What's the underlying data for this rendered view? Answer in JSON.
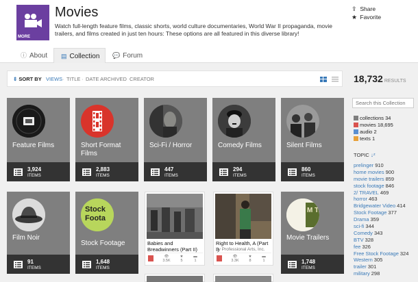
{
  "collection": {
    "logo_more": "MORE",
    "title": "Movies",
    "description": "Watch full-length feature films, classic shorts, world culture documentaries, World War II propaganda, movie trailers, and films created in just ten hours: These options are all featured in this diverse library!",
    "share_label": "Share",
    "favorite_label": "Favorite"
  },
  "tabs": [
    {
      "label": "About",
      "icon": "info-icon"
    },
    {
      "label": "Collection",
      "icon": "grid-icon",
      "active": true
    },
    {
      "label": "Forum",
      "icon": "chat-icon"
    }
  ],
  "sort": {
    "label": "SORT BY",
    "options": [
      "VIEWS",
      "TITLE",
      "DATE ARCHIVED",
      "CREATOR"
    ],
    "active": "VIEWS"
  },
  "results": {
    "count": "18,732",
    "label": "RESULTS"
  },
  "search": {
    "placeholder": "Search this Collection"
  },
  "media_facets": [
    {
      "label": "collections",
      "count": "34",
      "color": "#7f7f7f"
    },
    {
      "label": "movies",
      "count": "18,695",
      "color": "#d9534f"
    },
    {
      "label": "audio",
      "count": "2",
      "color": "#5b8fd1"
    },
    {
      "label": "texts",
      "count": "1",
      "color": "#e8a13a"
    }
  ],
  "topic_header": "TOPIC",
  "topics": [
    {
      "name": "prelinger",
      "count": "910"
    },
    {
      "name": "home movies",
      "count": "900"
    },
    {
      "name": "movie trailers",
      "count": "859"
    },
    {
      "name": "stock footage",
      "count": "846"
    },
    {
      "name": "2/ TRAVEL",
      "count": "469"
    },
    {
      "name": "horror",
      "count": "463"
    },
    {
      "name": "Bridgewater Video",
      "count": "414"
    },
    {
      "name": "Stock Footage",
      "count": "377"
    },
    {
      "name": "Drama",
      "count": "359"
    },
    {
      "name": "sci-fi",
      "count": "344"
    },
    {
      "name": "Comedy",
      "count": "343"
    },
    {
      "name": "BTV",
      "count": "328"
    },
    {
      "name": "fee",
      "count": "326"
    },
    {
      "name": "Free Stock Footage",
      "count": "324"
    },
    {
      "name": "Western",
      "count": "305"
    },
    {
      "name": "trailer",
      "count": "301"
    },
    {
      "name": "military",
      "count": "298"
    }
  ],
  "tiles": [
    {
      "name": "Feature Films",
      "count": "3,924",
      "items_label": "ITEMS"
    },
    {
      "name": "Short Format Films",
      "count": "2,883",
      "items_label": "ITEMS"
    },
    {
      "name": "Sci-Fi / Horror",
      "count": "447",
      "items_label": "ITEMS"
    },
    {
      "name": "Comedy Films",
      "count": "294",
      "items_label": "ITEMS"
    },
    {
      "name": "Silent Films",
      "count": "860",
      "items_label": "ITEMS"
    },
    {
      "name": "Film Noir",
      "count": "91",
      "items_label": "ITEMS"
    },
    {
      "name": "Stock Footage",
      "count": "1,648",
      "items_label": "ITEMS"
    },
    {
      "name": "Movie Trailers",
      "count": "1,748",
      "items_label": "ITEMS"
    }
  ],
  "tile_logo_texts": {
    "stock": "Stock Foota",
    "trailers": "M Tra"
  },
  "cards": [
    {
      "title": "Babies and Breadwinners (Part II)",
      "by": "",
      "views": "3.5K",
      "favs": "5",
      "reviews": "1"
    },
    {
      "title": "Right to Health, A (Part I)",
      "by": "by Professional Arts, Inc.",
      "views": "3.3K",
      "favs": "8",
      "reviews": "1"
    }
  ]
}
